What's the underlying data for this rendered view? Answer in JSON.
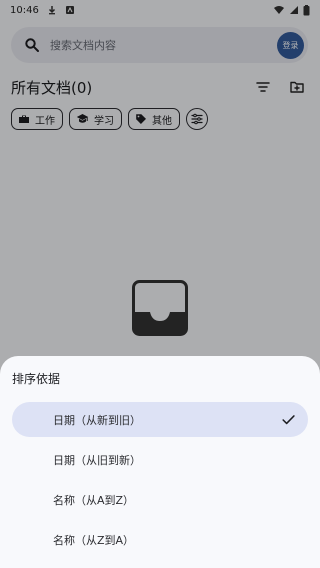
{
  "status_bar": {
    "time": "10:46"
  },
  "search": {
    "placeholder": "搜索文档内容",
    "login_label": "登录"
  },
  "page": {
    "title": "所有文档(0)"
  },
  "filters": {
    "chips": [
      {
        "label": "工作",
        "icon": "briefcase-icon"
      },
      {
        "label": "学习",
        "icon": "school-icon"
      },
      {
        "label": "其他",
        "icon": "tag-icon"
      }
    ],
    "adjust_icon": "tune-icon"
  },
  "empty_state": {
    "icon": "inbox-icon"
  },
  "sort_sheet": {
    "title": "排序依据",
    "options": [
      {
        "label": "日期（从新到旧）",
        "selected": true
      },
      {
        "label": "日期（从旧到新）",
        "selected": false
      },
      {
        "label": "名称（从A到Z）",
        "selected": false
      },
      {
        "label": "名称（从Z到A）",
        "selected": false
      }
    ]
  },
  "colors": {
    "background": "#f7f8fb",
    "search_background": "#e7e8ef",
    "login_button": "#335b9b",
    "selected_option": "#dde2f5",
    "scrim": "rgba(0,0,0,0.30)"
  }
}
